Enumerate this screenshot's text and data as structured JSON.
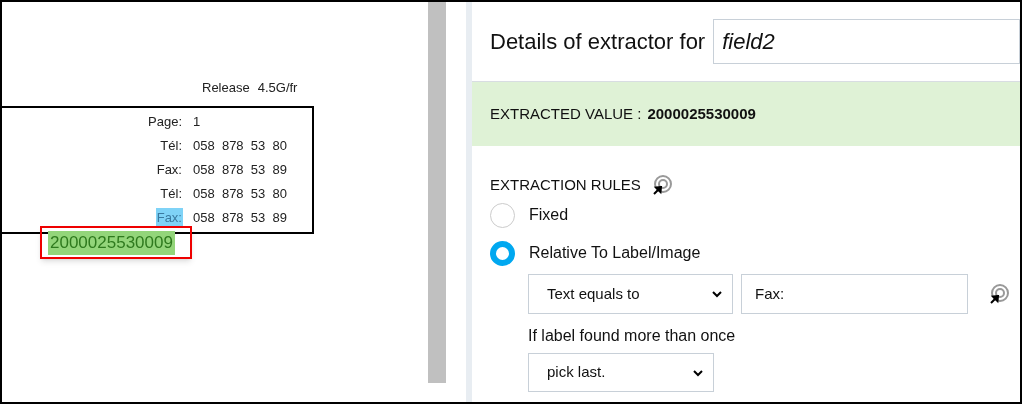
{
  "document": {
    "release_label": "Release",
    "release_value": "4.5G/fr",
    "rows": [
      {
        "label": "Page:",
        "value": "1",
        "highlighted": false
      },
      {
        "label": "Tél:",
        "value": "058  878  53  80",
        "highlighted": false
      },
      {
        "label": "Fax:",
        "value": "058  878  53  89",
        "highlighted": false
      },
      {
        "label": "Tél:",
        "value": "058  878  53  80",
        "highlighted": false
      },
      {
        "label": "Fax:",
        "value": "058  878  53  89",
        "highlighted": true
      }
    ],
    "selection": "2000025530009"
  },
  "panel": {
    "title": "Details of extractor for",
    "field_name": "field2",
    "extracted_label": "EXTRACTED VALUE :",
    "extracted_value": "2000025530009",
    "rules_heading": "EXTRACTION RULES",
    "options": [
      {
        "label": "Fixed",
        "selected": false
      },
      {
        "label": "Relative To Label/Image",
        "selected": true
      }
    ],
    "match_mode": "Text equals to",
    "label_value": "Fax:",
    "repeat_question": "If label found more than once",
    "repeat_choice": "pick last."
  }
}
